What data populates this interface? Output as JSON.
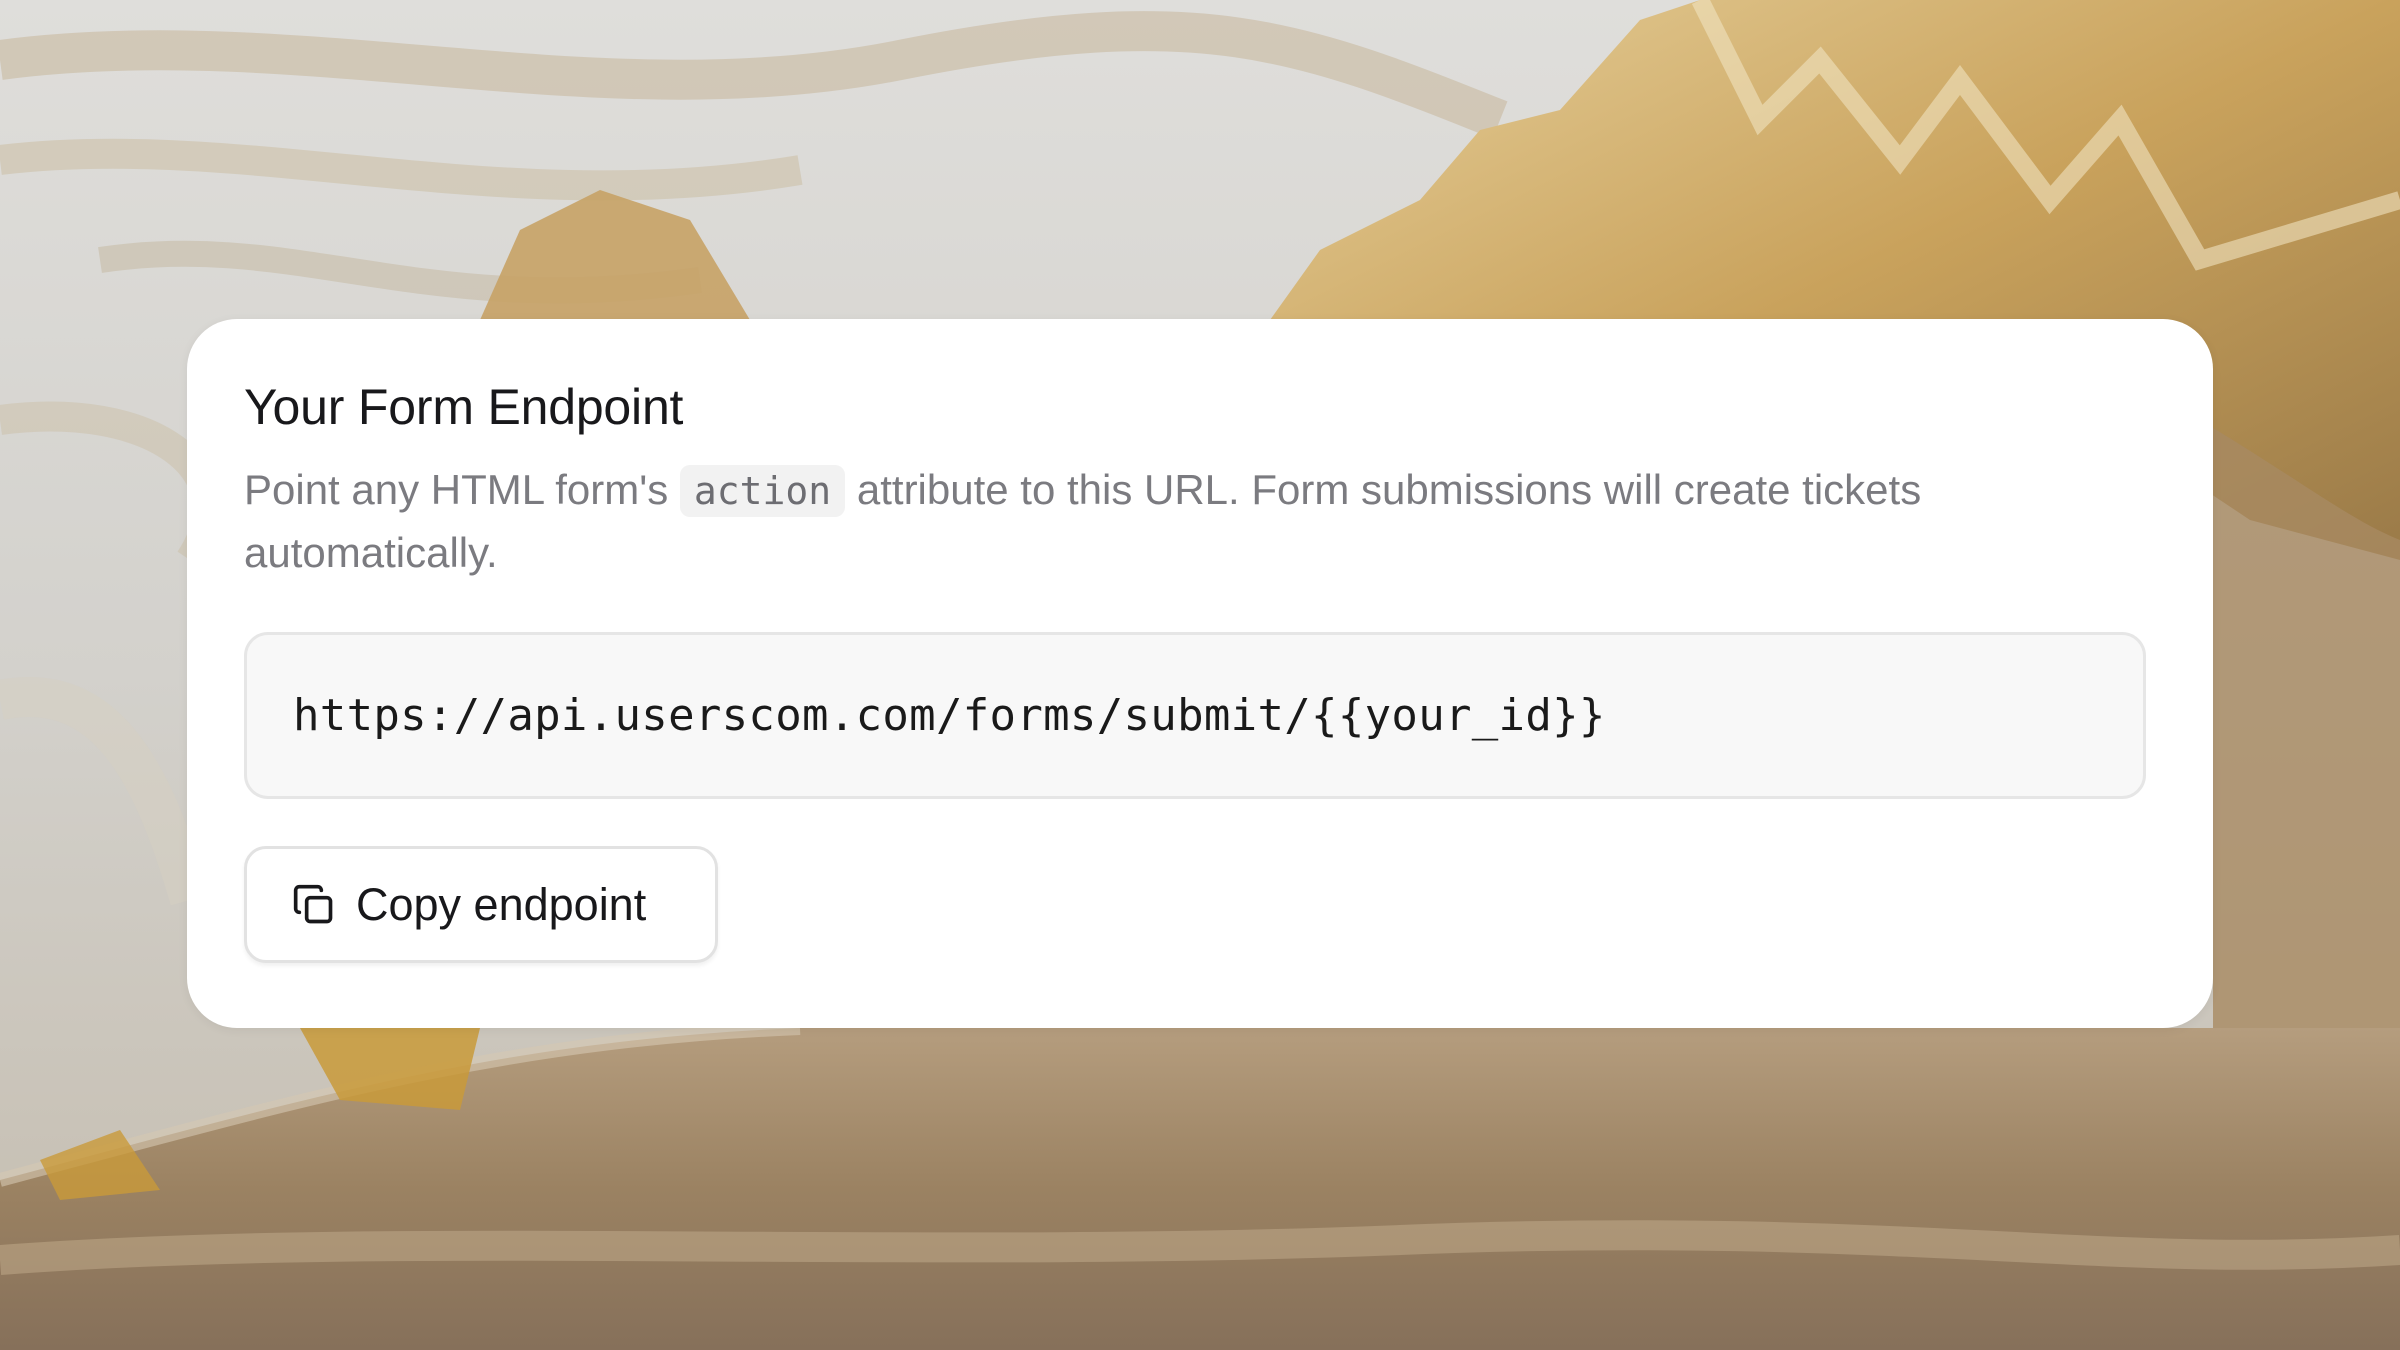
{
  "card": {
    "title": "Your Form Endpoint",
    "description_before": "Point any HTML form's ",
    "description_code": "action",
    "description_after": " attribute to this URL. Form submissions will create tickets automatically.",
    "endpoint_url": "https://api.userscom.com/forms/submit/{{your_id}}",
    "copy_button": {
      "label": "Copy endpoint",
      "icon": "copy-icon"
    }
  },
  "colors": {
    "card_background": "#ffffff",
    "title_text": "#18181b",
    "description_text": "#7b7b80",
    "endpoint_background": "#f8f8f8",
    "border": "#e6e6e6"
  }
}
